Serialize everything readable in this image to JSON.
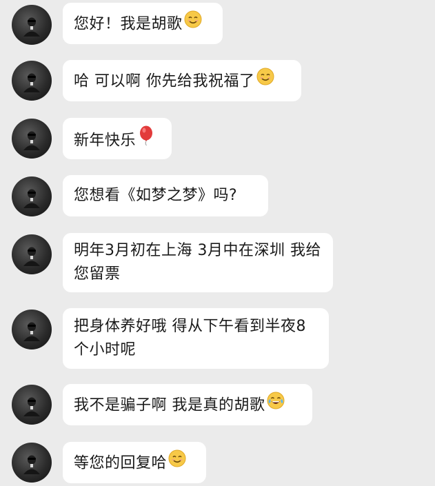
{
  "messages": [
    {
      "text": "您好！我是胡歌",
      "emoji": "smiling-face-icon"
    },
    {
      "text": "哈 可以啊 你先给我祝福了",
      "emoji": "smiling-face-icon"
    },
    {
      "text": "新年快乐",
      "emoji": "balloon-icon"
    },
    {
      "text": "您想看《如梦之梦》吗?",
      "emoji": ""
    },
    {
      "text": "明年3月初在上海 3月中在深圳 我给您留票",
      "emoji": ""
    },
    {
      "text": "把身体养好哦 得从下午看到半夜8个小时呢",
      "emoji": ""
    },
    {
      "text": "我不是骗子啊 我是真的胡歌",
      "emoji": "tears-of-joy-icon"
    },
    {
      "text": "等您的回复哈",
      "emoji": "smiling-face-icon"
    }
  ],
  "colors": {
    "background": "#ebebeb",
    "bubble": "#ffffff",
    "text": "#1a1a1a",
    "emoji_face": "#f7c948",
    "balloon": "#e23b3b"
  }
}
